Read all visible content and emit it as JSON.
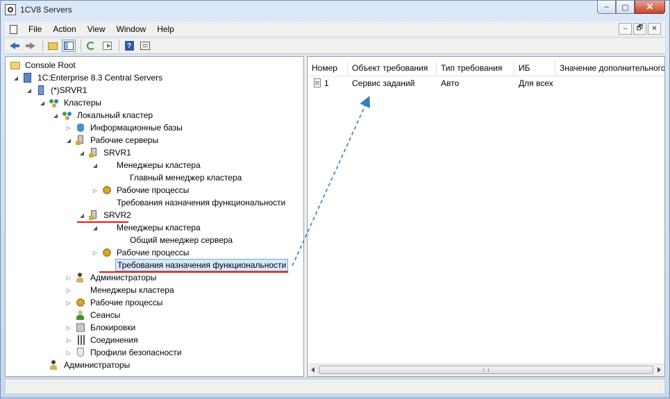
{
  "window": {
    "title": "1CV8 Servers"
  },
  "window_buttons": {
    "minimize": "–",
    "maximize": "▢",
    "close": "✕"
  },
  "menu": [
    "File",
    "Action",
    "View",
    "Window",
    "Help"
  ],
  "mdi_buttons": [
    "–",
    "🗗",
    "✕"
  ],
  "tree": {
    "root": "Console Root",
    "central_servers": "1C:Enterprise 8.3 Central Servers",
    "server": "(*)SRVR1",
    "clusters": "Кластеры",
    "local_cluster": "Локальный кластер",
    "infobases": "Информационные базы",
    "working_servers": "Рабочие серверы",
    "srvr1": "SRVR1",
    "srvr1_managers": "Менеджеры кластера",
    "srvr1_main_manager": "Главный менеджер кластера",
    "srvr1_processes": "Рабочие процессы",
    "srvr1_requirements": "Требования назначения функциональности",
    "srvr2": "SRVR2",
    "srvr2_managers": "Менеджеры кластера",
    "srvr2_common_manager": "Общий менеджер сервера",
    "srvr2_processes": "Рабочие процессы",
    "srvr2_requirements": "Требования назначения функциональности",
    "administrators": "Администраторы",
    "cluster_managers": "Менеджеры кластера",
    "processes": "Рабочие процессы",
    "sessions": "Сеансы",
    "locks": "Блокировки",
    "connections": "Соединения",
    "security_profiles": "Профили безопасности",
    "central_admins": "Администраторы"
  },
  "list": {
    "columns": [
      "Номер",
      "Объект требования",
      "Тип требования",
      "ИБ",
      "Значение дополнительного"
    ],
    "rows": [
      {
        "number": "1",
        "object": "Сервис заданий",
        "type": "Авто",
        "ib": "Для всех"
      }
    ]
  },
  "colors": {
    "highlight_line": "#e11111",
    "arrow": "#2f7fc0"
  }
}
